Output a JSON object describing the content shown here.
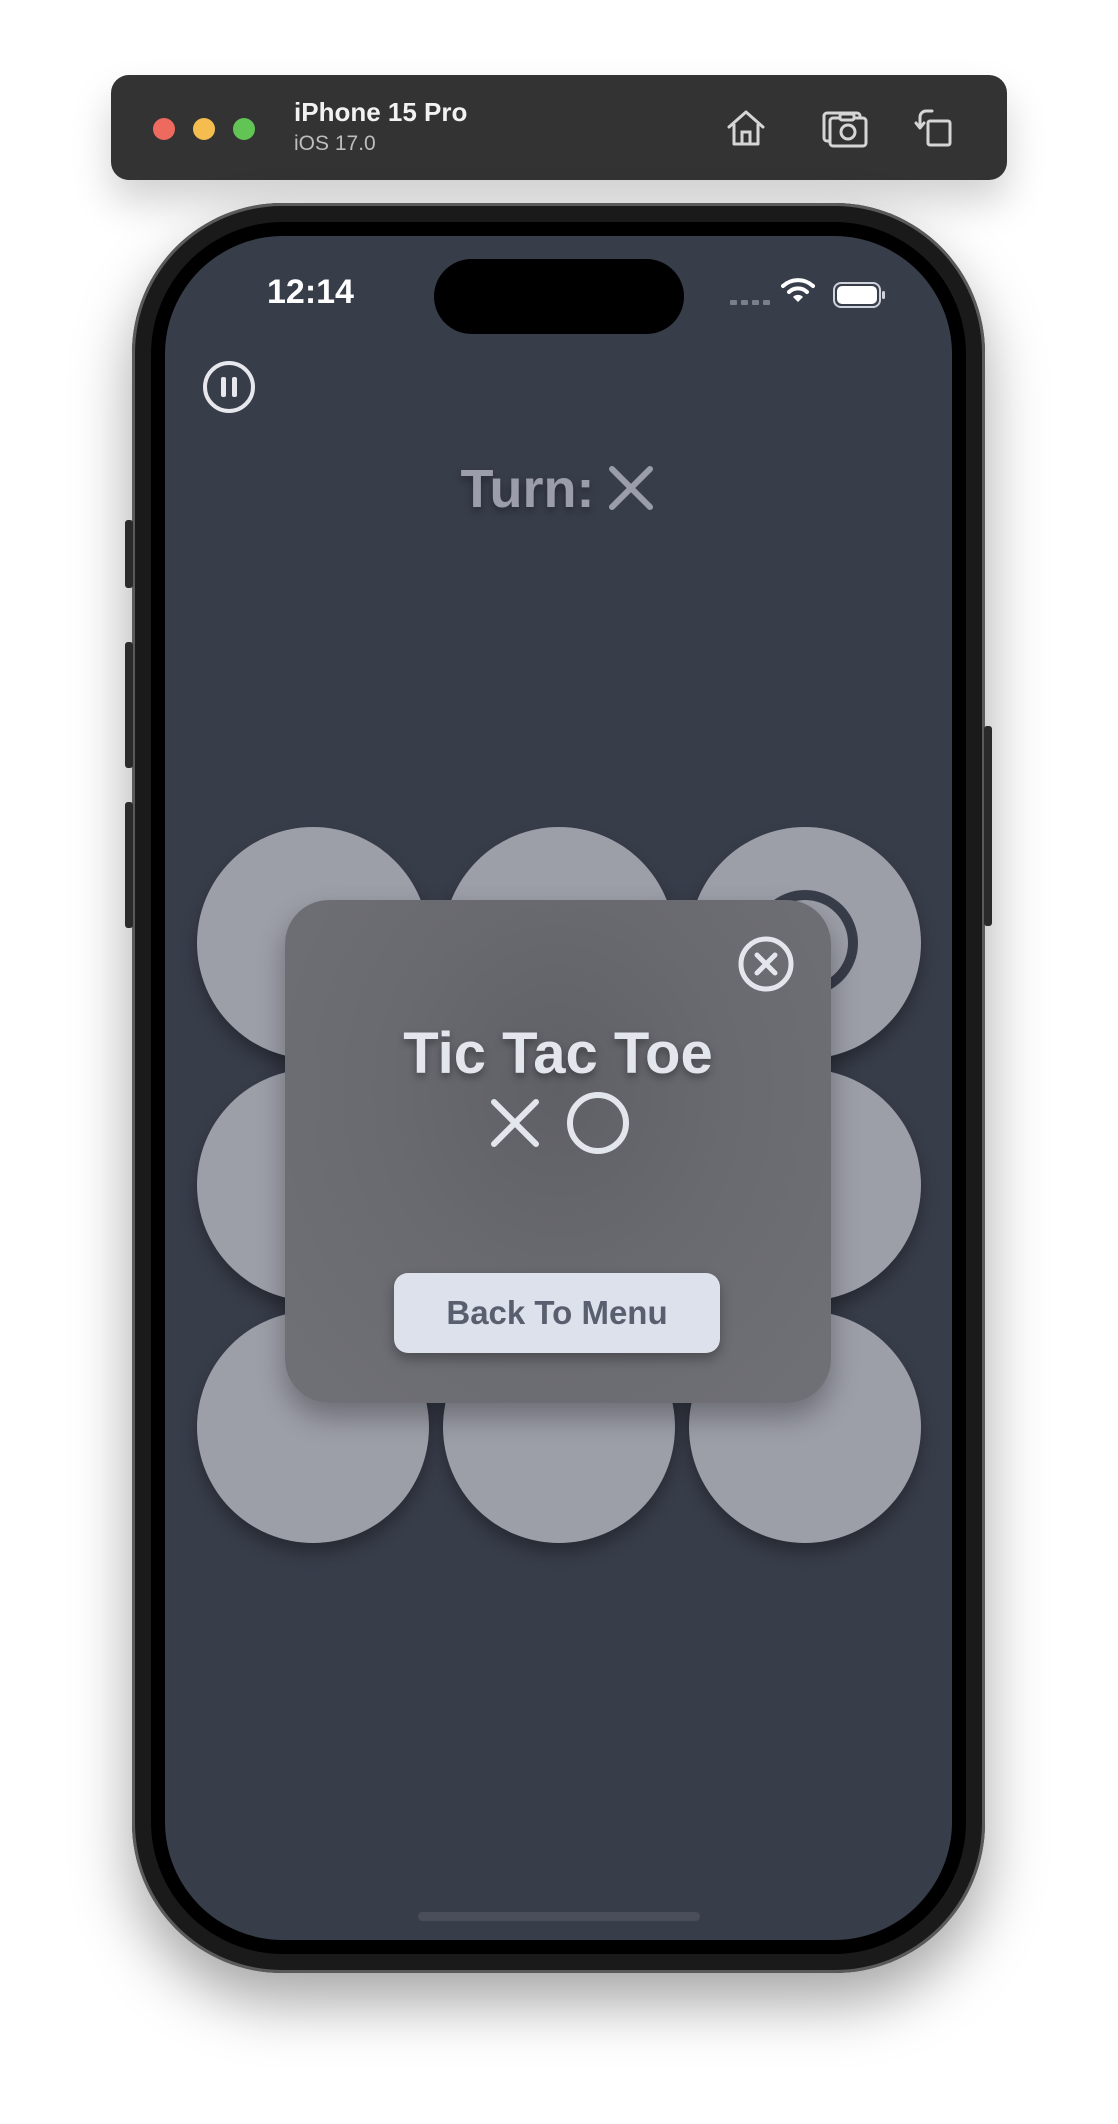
{
  "simulator": {
    "device_name": "iPhone 15 Pro",
    "os_version": "iOS 17.0",
    "toolbar_icons": [
      "home-icon",
      "screenshot-icon",
      "rotate-icon"
    ]
  },
  "status_bar": {
    "time": "12:14",
    "icons": [
      "cellular-signal-icon",
      "wifi-icon",
      "battery-icon"
    ]
  },
  "game": {
    "turn_label": "Turn:",
    "turn_symbol": "X",
    "board": [
      "",
      "",
      "O",
      "",
      "",
      "",
      "",
      "",
      ""
    ]
  },
  "modal": {
    "title": "Tic Tac Toe",
    "symbols": [
      "X",
      "O"
    ],
    "back_button_label": "Back To Menu"
  },
  "colors": {
    "screen_background": "#383d4a",
    "cell": "#9c9ea8",
    "button": "#dde1ec"
  }
}
